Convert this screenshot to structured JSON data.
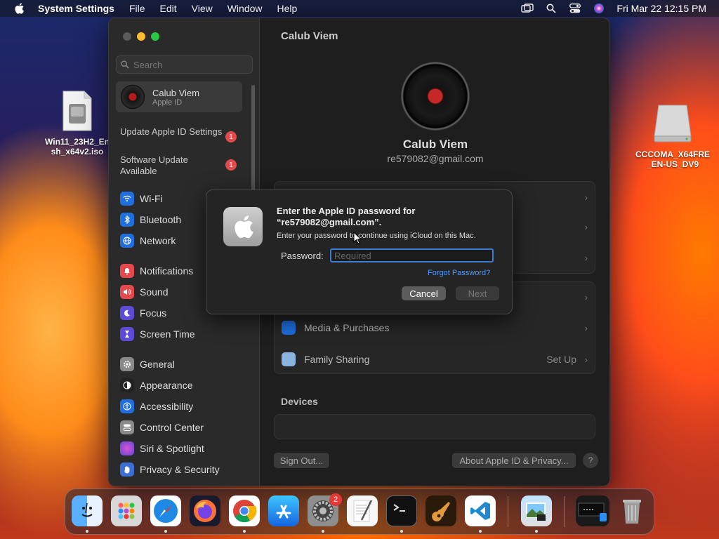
{
  "menubar": {
    "app_name": "System Settings",
    "items": [
      "File",
      "Edit",
      "View",
      "Window",
      "Help"
    ],
    "clock": "Fri Mar 22  12:15 PM"
  },
  "desktop": {
    "iso_file_label": "Win11_23H2_En\nsh_x64v2.iso",
    "drive_label": "CCCOMA_X64FRE\n_EN-US_DV9"
  },
  "sidebar": {
    "search_placeholder": "Search",
    "account": {
      "name": "Calub Viem",
      "subtitle": "Apple ID"
    },
    "notices": [
      {
        "label": "Update Apple ID Settings",
        "badge": "1"
      },
      {
        "label": "Software Update Available",
        "badge": "1"
      }
    ],
    "items": [
      {
        "label": "Wi-Fi",
        "color": "#1f6fe0"
      },
      {
        "label": "Bluetooth",
        "color": "#1f6fe0"
      },
      {
        "label": "Network",
        "color": "#1f6fe0"
      },
      {
        "label": "Notifications",
        "color": "#e5484d"
      },
      {
        "label": "Sound",
        "color": "#e5484d"
      },
      {
        "label": "Focus",
        "color": "#5b4bd6"
      },
      {
        "label": "Screen Time",
        "color": "#5b4bd6"
      },
      {
        "label": "General",
        "color": "#8a8a8a"
      },
      {
        "label": "Appearance",
        "color": "#222222"
      },
      {
        "label": "Accessibility",
        "color": "#1f6fe0"
      },
      {
        "label": "Control Center",
        "color": "#8a8a8a"
      },
      {
        "label": "Siri & Spotlight",
        "color": "#b04fd6"
      },
      {
        "label": "Privacy & Security",
        "color": "#3a6fd8"
      }
    ]
  },
  "main": {
    "title": "Calub Viem",
    "profile_name": "Calub Viem",
    "profile_email": "re579082@gmail.com",
    "rows": [
      {
        "label": "Media & Purchases",
        "value": ""
      },
      {
        "label": "Family Sharing",
        "value": "Set Up"
      }
    ],
    "devices_heading": "Devices",
    "sign_out": "Sign Out...",
    "about": "About Apple ID & Privacy...",
    "help": "?"
  },
  "dialog": {
    "title": "Enter the Apple ID password for “re579082@gmail.com”.",
    "message": "Enter your password to continue using iCloud on this Mac.",
    "password_label": "Password:",
    "password_placeholder": "Required",
    "forgot": "Forgot Password?",
    "cancel": "Cancel",
    "next": "Next"
  },
  "dock": {
    "settings_badge": "2",
    "apps": [
      "Finder",
      "Launchpad",
      "Safari",
      "Firefox",
      "Chrome",
      "App Store",
      "System Settings",
      "TextEdit",
      "Terminal",
      "GarageBand",
      "Visual Studio Code",
      "Preview",
      "Screen Sharing",
      "Trash"
    ]
  }
}
